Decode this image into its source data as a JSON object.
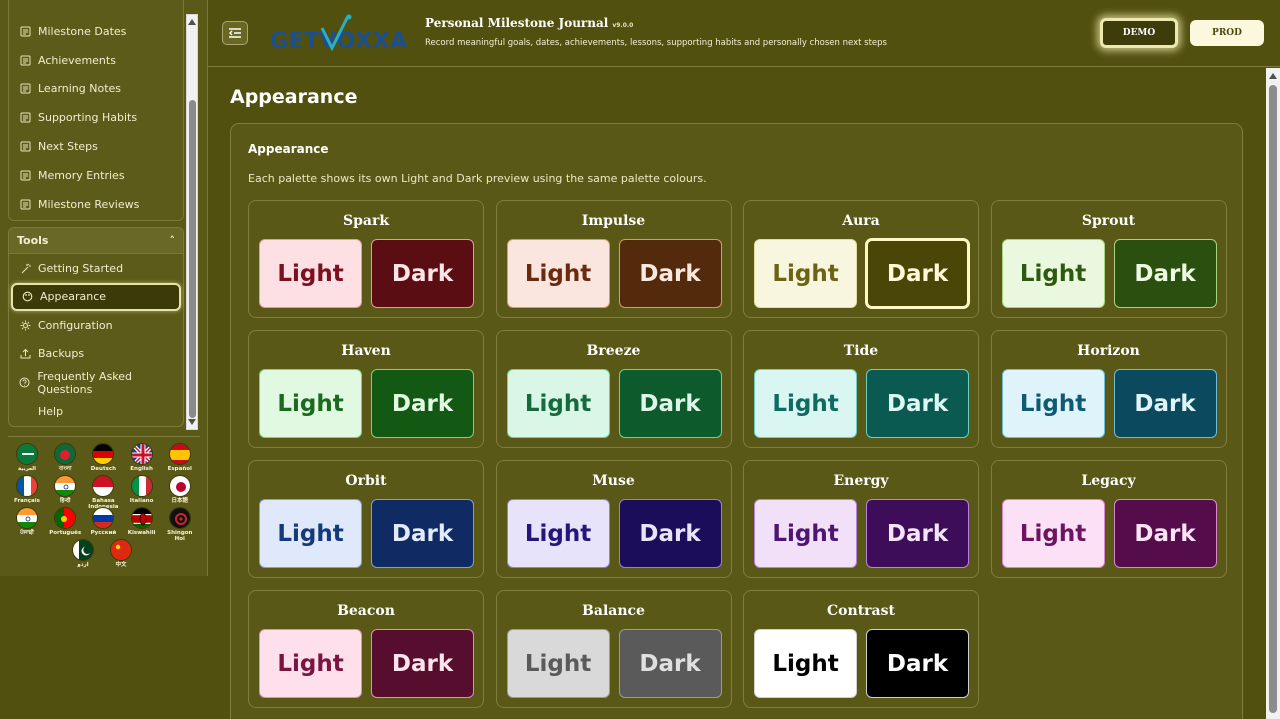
{
  "sidebar": {
    "nav_items": [
      {
        "label": "Milestone Dates",
        "icon": "list-icon"
      },
      {
        "label": "Achievements",
        "icon": "list-icon"
      },
      {
        "label": "Learning Notes",
        "icon": "list-icon"
      },
      {
        "label": "Supporting Habits",
        "icon": "list-icon"
      },
      {
        "label": "Next Steps",
        "icon": "list-icon"
      },
      {
        "label": "Memory Entries",
        "icon": "list-icon"
      },
      {
        "label": "Milestone Reviews",
        "icon": "list-icon"
      }
    ],
    "tools": {
      "heading": "Tools",
      "toggle": "˄",
      "items": [
        {
          "label": "Getting Started",
          "icon": "wand-icon"
        },
        {
          "label": "Appearance",
          "icon": "palette-icon",
          "active": true
        },
        {
          "label": "Configuration",
          "icon": "gear-icon"
        },
        {
          "label": "Backups",
          "icon": "upload-icon"
        },
        {
          "label": "Frequently Asked Questions",
          "icon": "question-icon"
        },
        {
          "label": "Help",
          "icon": ""
        }
      ]
    },
    "languages": [
      {
        "label": "العربية",
        "flag": "sa"
      },
      {
        "label": "বাংলা",
        "flag": "bd"
      },
      {
        "label": "Deutsch",
        "flag": "de"
      },
      {
        "label": "English",
        "flag": "gb"
      },
      {
        "label": "Español",
        "flag": "es"
      },
      {
        "label": "Français",
        "flag": "fr"
      },
      {
        "label": "हिन्दी",
        "flag": "in"
      },
      {
        "label": "Bahasa Indonesia",
        "flag": "id"
      },
      {
        "label": "Italiano",
        "flag": "it"
      },
      {
        "label": "日本語",
        "flag": "jp"
      },
      {
        "label": "ਪੰਜਾਬੀ",
        "flag": "in"
      },
      {
        "label": "Português",
        "flag": "pt"
      },
      {
        "label": "Русский",
        "flag": "ru"
      },
      {
        "label": "Kiswahili",
        "flag": "ke"
      },
      {
        "label": "Shingon Hoi",
        "flag": "custom"
      },
      {
        "label": "اردو",
        "flag": "pk"
      },
      {
        "label": "中文",
        "flag": "cn"
      }
    ]
  },
  "header": {
    "logo_text": "GETVOXXA",
    "title": "Personal Milestone Journal",
    "version": "v9.0.0",
    "subtitle": "Record meaningful goals, dates, achievements, lessons, supporting habits and personally chosen next steps",
    "demo_label": "DEMO",
    "prod_label": "PROD"
  },
  "main": {
    "page_title": "Appearance",
    "card_title": "Appearance",
    "card_desc": "Each palette shows its own Light and Dark preview using the same palette colours.",
    "light_label": "Light",
    "dark_label": "Dark",
    "palettes": [
      {
        "name": "Spark",
        "light_bg": "#fde0e4",
        "light_fg": "#7a1020",
        "dark_bg": "#5a0d12",
        "dark_fg": "#fde4e6",
        "border": "#e59aa3"
      },
      {
        "name": "Impulse",
        "light_bg": "#fbe6df",
        "light_fg": "#6b2a10",
        "dark_bg": "#542a0d",
        "dark_fg": "#fde9dd",
        "border": "#d99a6a"
      },
      {
        "name": "Aura",
        "light_bg": "#f9f6df",
        "light_fg": "#6c6415",
        "dark_bg": "#4a4608",
        "dark_fg": "#fff9d8",
        "border": "#e4dd9a",
        "selected": "dark"
      },
      {
        "name": "Sprout",
        "light_bg": "#eaf8df",
        "light_fg": "#2e5a0f",
        "dark_bg": "#2a4f0e",
        "dark_fg": "#edfbe2",
        "border": "#a6d47e"
      },
      {
        "name": "Haven",
        "light_bg": "#e0f9e0",
        "light_fg": "#1a6b1f",
        "dark_bg": "#135813",
        "dark_fg": "#e3fbe3",
        "border": "#77d47b"
      },
      {
        "name": "Breeze",
        "light_bg": "#d9f6e6",
        "light_fg": "#156b3d",
        "dark_bg": "#0d5a2c",
        "dark_fg": "#ddf7e8",
        "border": "#6bd29a"
      },
      {
        "name": "Tide",
        "light_bg": "#d9f6f3",
        "light_fg": "#0f6b60",
        "dark_bg": "#0b5a52",
        "dark_fg": "#dcf8f4",
        "border": "#68cfc2"
      },
      {
        "name": "Horizon",
        "light_bg": "#dff3fb",
        "light_fg": "#0e5a73",
        "dark_bg": "#0b4a5e",
        "dark_fg": "#e0f4fb",
        "border": "#6cbcd8"
      },
      {
        "name": "Orbit",
        "light_bg": "#e0e9fb",
        "light_fg": "#143a7a",
        "dark_bg": "#102a63",
        "dark_fg": "#e2eafb",
        "border": "#7c9fe0"
      },
      {
        "name": "Muse",
        "light_bg": "#e6e3fb",
        "light_fg": "#26157a",
        "dark_bg": "#1c0d5a",
        "dark_fg": "#e8e4fc",
        "border": "#8e80e0"
      },
      {
        "name": "Energy",
        "light_bg": "#f2e0f9",
        "light_fg": "#4e1673",
        "dark_bg": "#3e0d5a",
        "dark_fg": "#f3e3fb",
        "border": "#b982dc"
      },
      {
        "name": "Legacy",
        "light_bg": "#fbe0f6",
        "light_fg": "#6b1460",
        "dark_bg": "#540c4a",
        "dark_fg": "#fce3f6",
        "border": "#d888ca"
      },
      {
        "name": "Beacon",
        "light_bg": "#fde0ec",
        "light_fg": "#7a1440",
        "dark_bg": "#560d2e",
        "dark_fg": "#fde3ee",
        "border": "#e28eb2"
      },
      {
        "name": "Balance",
        "light_bg": "#d9d9d9",
        "light_fg": "#5a5a5a",
        "dark_bg": "#5a5a5a",
        "dark_fg": "#e0e0e0",
        "border": "#9a9a9a"
      },
      {
        "name": "Contrast",
        "light_bg": "#ffffff",
        "light_fg": "#000000",
        "dark_bg": "#000000",
        "dark_fg": "#ffffff",
        "border": "#cfcfcf"
      }
    ]
  }
}
